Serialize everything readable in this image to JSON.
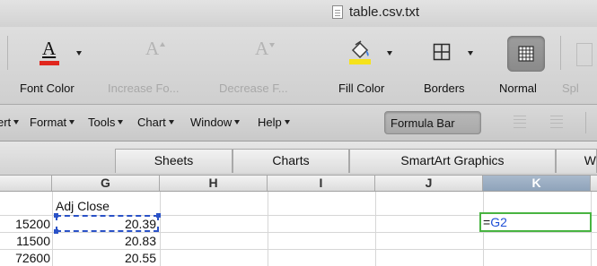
{
  "window": {
    "title": "table.csv.txt"
  },
  "ribbon": {
    "font_color": {
      "label": "Font Color",
      "glyph": "A",
      "accent": "#e0261d"
    },
    "increase_font": {
      "label": "Increase Fo...",
      "glyph": "A"
    },
    "decrease_font": {
      "label": "Decrease F...",
      "glyph": "A"
    },
    "fill_color": {
      "label": "Fill Color",
      "accent": "#f5e21b"
    },
    "borders": {
      "label": "Borders"
    },
    "normal": {
      "label": "Normal"
    },
    "split": {
      "label": "Spl"
    }
  },
  "menu": {
    "items": [
      "ert",
      "Format",
      "Tools",
      "Chart",
      "Window",
      "Help"
    ],
    "formula_bar": "Formula Bar"
  },
  "tabs": [
    "Sheets",
    "Charts",
    "SmartArt Graphics",
    "W"
  ],
  "sheet": {
    "columns": [
      "G",
      "H",
      "I",
      "J",
      "K"
    ],
    "selected_column": "K",
    "rows": [
      {
        "left": "",
        "g": "Adj Close"
      },
      {
        "left": "15200",
        "g": "20.39"
      },
      {
        "left": "11500",
        "g": "20.83"
      },
      {
        "left": "72600",
        "g": "20.55"
      }
    ],
    "edit_cell": {
      "eq": "=",
      "ref": "G2"
    }
  }
}
